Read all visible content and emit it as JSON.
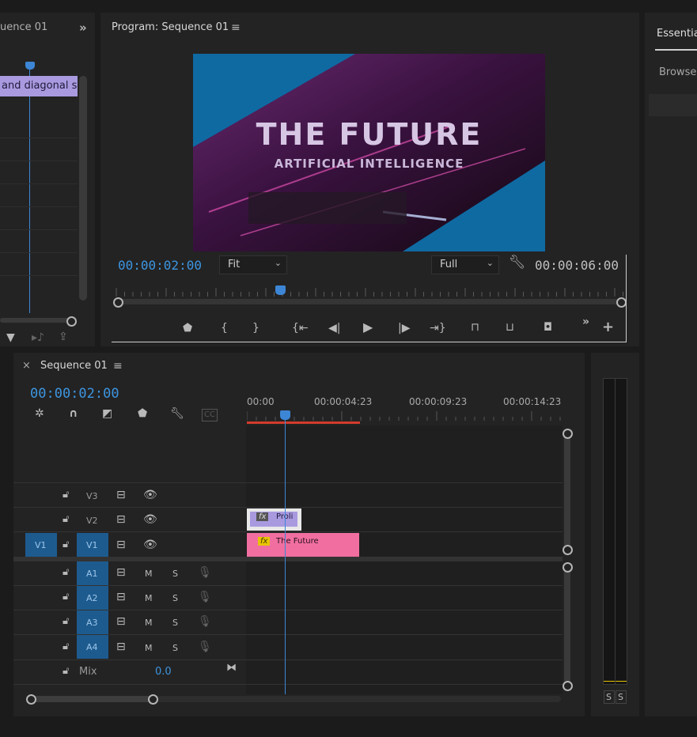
{
  "source_panel": {
    "tab_label": "uence 01",
    "clip_text": "and diagonal sp",
    "expand_icon": "double-chevron-right-icon"
  },
  "program_monitor": {
    "title": "Program: Sequence 01",
    "menu_icon": "hamburger-icon",
    "video_title": "THE FUTURE",
    "video_subtitle": "ARTIFICIAL INTELLIGENCE",
    "current_time": "00:00:02:00",
    "zoom_select": "Fit",
    "resolution_select": "Full",
    "duration": "00:00:06:00",
    "playhead_fraction": 0.33
  },
  "essentials": {
    "tab_label": "Essentia",
    "browse_label": "Browse"
  },
  "timeline": {
    "close_icon": "×",
    "tab_label": "Sequence 01",
    "current_time": "00:00:02:00",
    "ruler": [
      "00:00",
      "00:00:04:23",
      "00:00:09:23",
      "00:00:14:23"
    ],
    "video_tracks": [
      {
        "source": "",
        "name": "V3"
      },
      {
        "source": "",
        "name": "V2"
      },
      {
        "source": "V1",
        "name": "V1"
      }
    ],
    "audio_tracks": [
      {
        "name": "A1",
        "m": "M",
        "s": "S"
      },
      {
        "name": "A2",
        "m": "M",
        "s": "S"
      },
      {
        "name": "A3",
        "m": "M",
        "s": "S"
      },
      {
        "name": "A4",
        "m": "M",
        "s": "S"
      }
    ],
    "mix_label": "Mix",
    "mix_value": "0.0",
    "clips": [
      {
        "track": "V2",
        "fx": "fx",
        "label": "Proli"
      },
      {
        "track": "V1",
        "fx": "fx",
        "label": "The Future"
      }
    ]
  },
  "audio_meter": {
    "solo_left": "S",
    "solo_right": "S"
  },
  "colors": {
    "accent_blue": "#3d95e0",
    "clip_pink": "#f06fa0",
    "clip_purple": "#a99ae0",
    "work_area_red": "#d33b2c"
  }
}
